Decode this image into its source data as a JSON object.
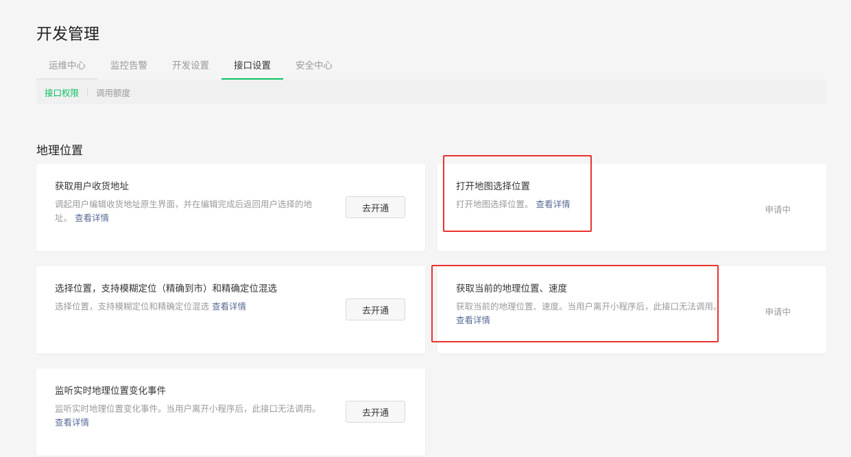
{
  "page": {
    "title": "开发管理"
  },
  "tabs": [
    {
      "label": "运维中心"
    },
    {
      "label": "监控告警"
    },
    {
      "label": "开发设置"
    },
    {
      "label": "接口设置"
    },
    {
      "label": "安全中心"
    }
  ],
  "subnav": [
    {
      "label": "接口权限"
    },
    {
      "label": "调用额度"
    }
  ],
  "section": {
    "title": "地理位置"
  },
  "cards": [
    {
      "title": "获取用户收货地址",
      "desc": "调起用户编辑收货地址原生界面，并在编辑完成后返回用户选择的地",
      "desc2": "址。",
      "link": "查看详情",
      "action": "去开通"
    },
    {
      "title": "打开地图选择位置",
      "desc": "打开地图选择位置。",
      "link": "查看详情",
      "status": "申请中"
    },
    {
      "title": "选择位置，支持模糊定位（精确到市）和精确定位混选",
      "desc": "选择位置，支持模糊定位和精确定位混选",
      "link": "查看详情",
      "action": "去开通"
    },
    {
      "title": "获取当前的地理位置、速度",
      "desc": "获取当前的地理位置、速度。当用户离开小程序后，此接口无法调用。",
      "link": "查看详情",
      "status": "申请中"
    },
    {
      "title": "监听实时地理位置变化事件",
      "desc": "监听实时地理位置变化事件。当用户离开小程序后，此接口无法调用。",
      "link": "查看详情",
      "action": "去开通"
    }
  ],
  "colors": {
    "accent": "#07c160",
    "link": "#576b95",
    "highlight": "#e8322d"
  }
}
